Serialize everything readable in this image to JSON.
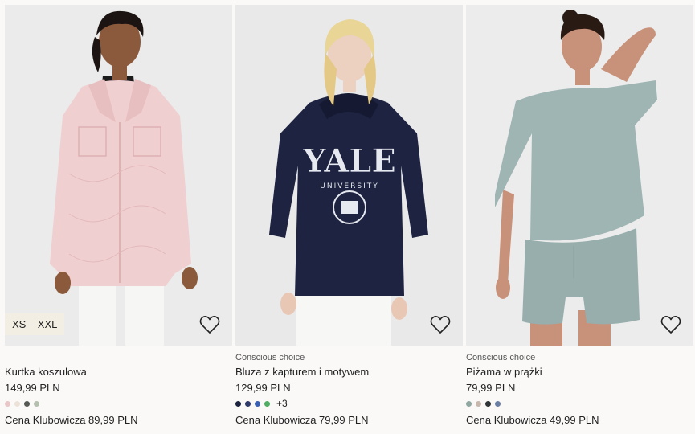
{
  "products": [
    {
      "size_badge": "XS – XXL",
      "conscious": "",
      "title": "Kurtka koszulowa",
      "price": "149,99 PLN",
      "swatches": [
        "#e9c6c8",
        "#ece2d8",
        "#555a55",
        "#b4bfae"
      ],
      "more": "",
      "club_price": "Cena Klubowicza 89,99 PLN",
      "image_bg": "#ebebeb",
      "garment_color": "#f0cfd0"
    },
    {
      "size_badge": "",
      "conscious": "Conscious choice",
      "title": "Bluza z kapturem i motywem",
      "price": "129,99 PLN",
      "swatches": [
        "#1b2340",
        "#2e3b6a",
        "#3a5fb0",
        "#4fae63"
      ],
      "more": "+3",
      "club_price": "Cena Klubowicza 79,99 PLN",
      "image_bg": "#e9e9ea",
      "garment_color": "#1d2340",
      "print_main": "YALE",
      "print_sub": "UNIVERSITY"
    },
    {
      "size_badge": "",
      "conscious": "Conscious choice",
      "title": "Piżama w prążki",
      "price": "79,99 PLN",
      "swatches": [
        "#8fa9a2",
        "#c8b7ad",
        "#2f3536",
        "#6b7fa5"
      ],
      "more": "",
      "club_price": "Cena Klubowicza 49,99 PLN",
      "image_bg": "#ececec",
      "garment_color": "#9fb5b3"
    }
  ]
}
